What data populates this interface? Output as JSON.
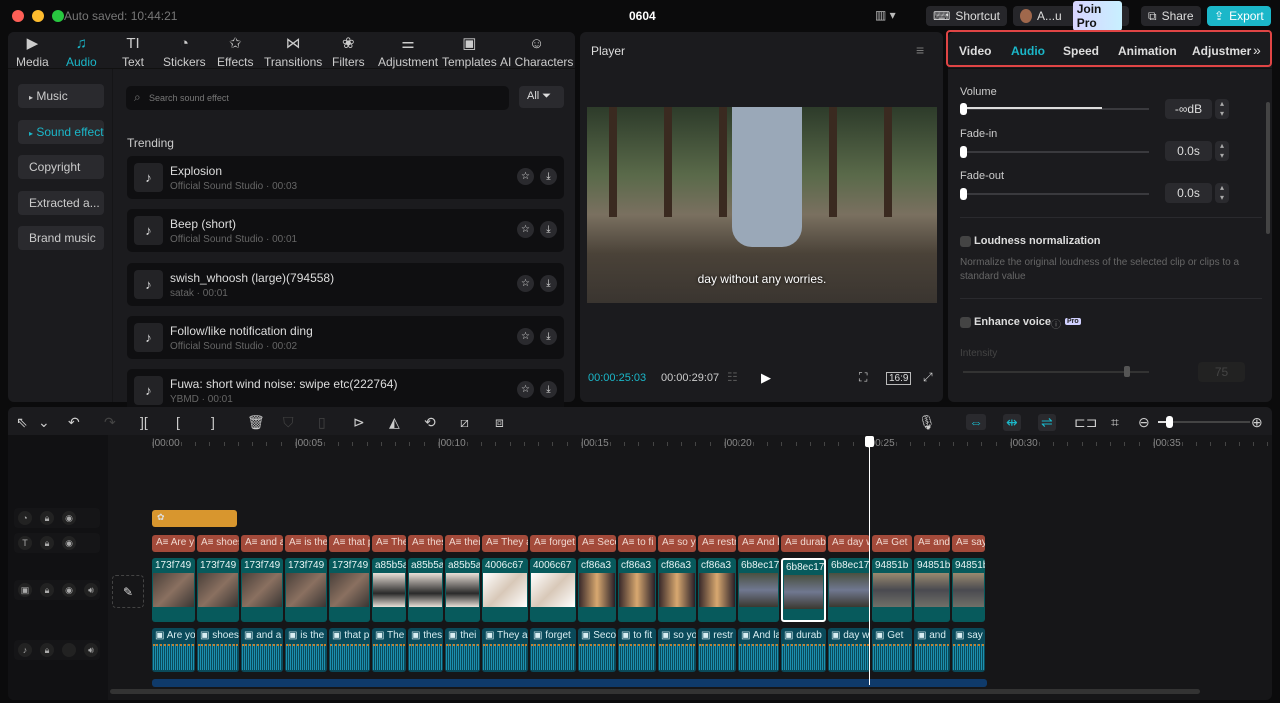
{
  "window": {
    "autosave": "Auto saved: 10:44:21",
    "title": "0604"
  },
  "topbar": {
    "shortcut": "Shortcut",
    "user": "A...u",
    "join_pro": "Join Pro",
    "share": "Share",
    "export": "Export"
  },
  "nav_tabs": [
    {
      "label": "Media",
      "icon": "▶"
    },
    {
      "label": "Audio",
      "icon": "♫"
    },
    {
      "label": "Text",
      "icon": "TI"
    },
    {
      "label": "Stickers",
      "icon": "◔"
    },
    {
      "label": "Effects",
      "icon": "✩"
    },
    {
      "label": "Transitions",
      "icon": "⋈"
    },
    {
      "label": "Filters",
      "icon": "❀"
    },
    {
      "label": "Adjustment",
      "icon": "⚌"
    },
    {
      "label": "Templates",
      "icon": "▣"
    },
    {
      "label": "AI Characters",
      "icon": "☺"
    }
  ],
  "sidebar": [
    {
      "label": "Music",
      "arrow": "▸"
    },
    {
      "label": "Sound effects",
      "arrow": "▸"
    },
    {
      "label": "Copyright"
    },
    {
      "label": "Extracted a..."
    },
    {
      "label": "Brand music"
    }
  ],
  "search": {
    "placeholder": "Search sound effect",
    "filter": "All"
  },
  "section": "Trending",
  "sounds": [
    {
      "title": "Explosion",
      "sub": "Official Sound Studio · 00:03"
    },
    {
      "title": "Beep (short)",
      "sub": "Official Sound Studio · 00:01"
    },
    {
      "title": "swish_whoosh (large)(794558)",
      "sub": "satak · 00:01"
    },
    {
      "title": "Follow/like notification ding",
      "sub": "Official Sound Studio · 00:02"
    },
    {
      "title": "Fuwa: short wind noise: swipe etc(222764)",
      "sub": "YBMD · 00:01"
    }
  ],
  "player": {
    "title": "Player",
    "subtitle": "day without any worries.",
    "current": "00:00:25:03",
    "total": "00:00:29:07",
    "ratio": "16:9"
  },
  "inspector": {
    "tabs": [
      "Video",
      "Audio",
      "Speed",
      "Animation",
      "Adjustmer"
    ],
    "active": "Audio",
    "volume_label": "Volume",
    "volume_value": "-∞dB",
    "volume_level": 0.0,
    "fadein_label": "Fade-in",
    "fadein_value": "0.0s",
    "fadeout_label": "Fade-out",
    "fadeout_value": "0.0s",
    "loudness_label": "Loudness normalization",
    "loudness_desc": "Normalize the original loudness of the selected clip or clips to a standard value",
    "enhance_label": "Enhance voice",
    "pro": "Pro",
    "intensity_label": "Intensity",
    "intensity_value": "75"
  },
  "timeline": {
    "ticks": [
      "00:00",
      "00:05",
      "00:10",
      "00:15",
      "00:20",
      "00:25",
      "00:30",
      "00:35"
    ],
    "captions": [
      "Are y",
      "shoes",
      "and a",
      "is the",
      "that p",
      "The",
      "thes",
      "thei",
      "They a",
      "forget",
      "Seco",
      "to fi",
      "so y",
      "restr",
      "And la",
      "durab",
      "day w",
      "Get",
      "and",
      "say"
    ],
    "videos": [
      "173f749",
      "173f749",
      "173f749",
      "173f749",
      "173f749",
      "a85b5a",
      "a85b5a",
      "a85b5a",
      "4006c67",
      "4006c67",
      "cf86a3",
      "cf86a3",
      "cf86a3",
      "cf86a3",
      "6b8ec17",
      "6b8ec17",
      "6b8ec17",
      "94851b",
      "94851b",
      "94851b"
    ],
    "audio": [
      "Are yo",
      "shoes",
      "and a",
      "is the",
      "that p",
      "The",
      "thes",
      "thei",
      "They a",
      "forget",
      "Seco",
      "to fit",
      "so yo",
      "restr",
      "And la",
      "durab",
      "day w",
      "Get",
      "and",
      "say g"
    ]
  }
}
